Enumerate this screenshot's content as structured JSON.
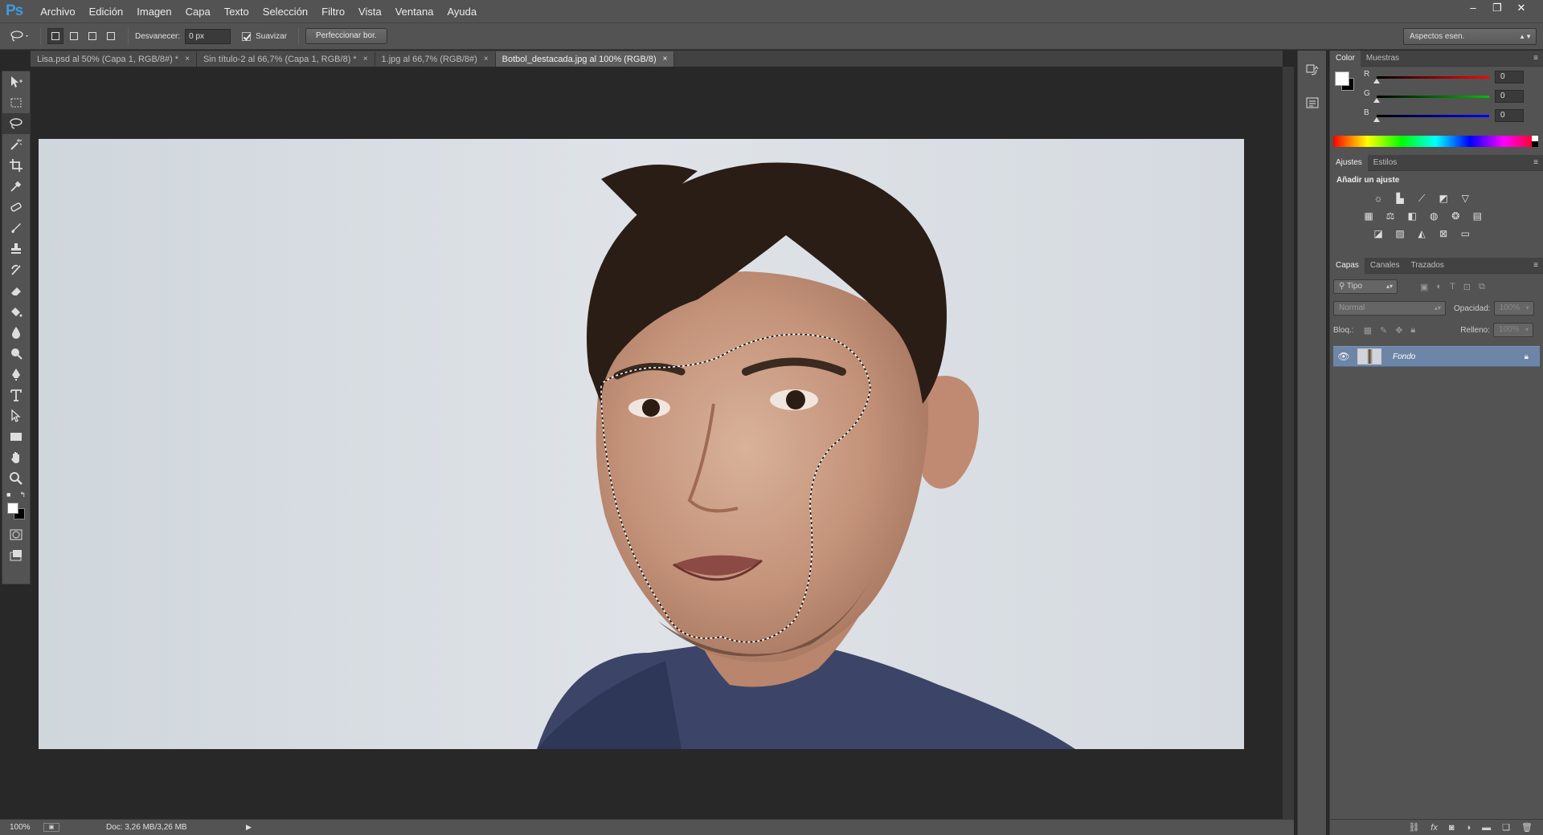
{
  "app": {
    "logo": "Ps"
  },
  "menubar": {
    "items": [
      "Archivo",
      "Edición",
      "Imagen",
      "Capa",
      "Texto",
      "Selección",
      "Filtro",
      "Vista",
      "Ventana",
      "Ayuda"
    ]
  },
  "window_controls": {
    "minimize": "–",
    "restore": "❐",
    "close": "✕"
  },
  "options_bar": {
    "feather_label": "Desvanecer:",
    "feather_value": "0 px",
    "antialias_label": "Suavizar",
    "refine_button": "Perfeccionar bor.",
    "workspace": "Aspectos esen."
  },
  "tabs": [
    {
      "label": "Lisa.psd al 50% (Capa 1, RGB/8#) *",
      "active": false
    },
    {
      "label": "Sin título-2 al 66,7% (Capa 1, RGB/8) *",
      "active": false
    },
    {
      "label": "1.jpg al 66,7% (RGB/8#)",
      "active": false
    },
    {
      "label": "Botbol_destacada.jpg al 100% (RGB/8)",
      "active": true
    }
  ],
  "tab_close": "×",
  "statusbar": {
    "zoom": "100%",
    "doc": "Doc: 3,26 MB/3,26 MB"
  },
  "color_panel": {
    "tabs": [
      "Color",
      "Muestras"
    ],
    "channels": [
      {
        "label": "R",
        "value": "0",
        "color": "#ff0000"
      },
      {
        "label": "G",
        "value": "0",
        "color": "#00c000"
      },
      {
        "label": "B",
        "value": "0",
        "color": "#0000ff"
      }
    ],
    "foreground": "#ffffff",
    "background": "#000000"
  },
  "adjustments_panel": {
    "tabs": [
      "Ajustes",
      "Estilos"
    ],
    "heading": "Añadir un ajuste"
  },
  "layers_panel": {
    "tabs": [
      "Capas",
      "Canales",
      "Trazados"
    ],
    "filter": "Tipo",
    "blend_mode": "Normal",
    "opacity_label": "Opacidad:",
    "opacity_value": "100%",
    "lock_label": "Bloq.:",
    "fill_label": "Relleno:",
    "fill_value": "100%",
    "layers": [
      {
        "name": "Fondo",
        "visible": true,
        "locked": true
      }
    ]
  }
}
